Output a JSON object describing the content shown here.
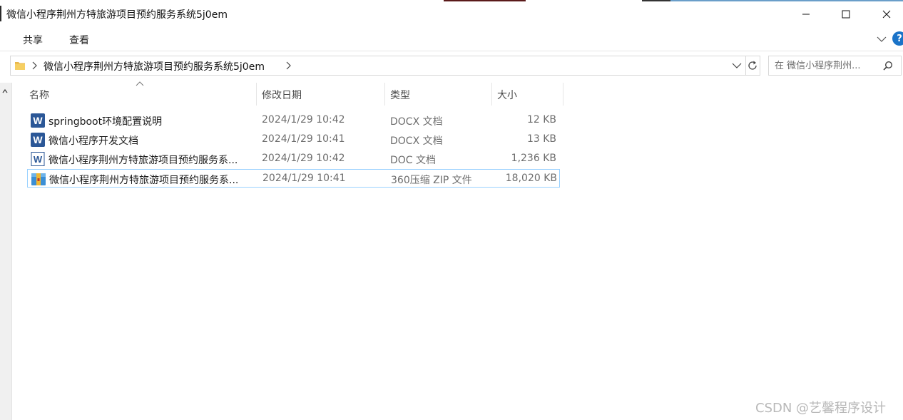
{
  "window": {
    "title": "微信小程序荆州方特旅游项目预约服务系统5j0em"
  },
  "ribbon": {
    "tabs": [
      "共享",
      "查看"
    ]
  },
  "address": {
    "path": "微信小程序荆州方特旅游项目预约服务系统5j0em"
  },
  "search": {
    "placeholder": "在 微信小程序荆州..."
  },
  "columns": {
    "name": "名称",
    "date": "修改日期",
    "type": "类型",
    "size": "大小"
  },
  "files": [
    {
      "name": "springboot环境配置说明",
      "date": "2024/1/29 10:42",
      "type": "DOCX 文档",
      "size": "12 KB",
      "icon": "word-docx-icon"
    },
    {
      "name": "微信小程序开发文档",
      "date": "2024/1/29 10:41",
      "type": "DOCX 文档",
      "size": "13 KB",
      "icon": "word-docx-icon"
    },
    {
      "name": "微信小程序荆州方特旅游项目预约服务系...",
      "date": "2024/1/29 10:42",
      "type": "DOC 文档",
      "size": "1,236 KB",
      "icon": "word-doc-icon"
    },
    {
      "name": "微信小程序荆州方特旅游项目预约服务系...",
      "date": "2024/1/29 10:41",
      "type": "360压缩 ZIP 文件",
      "size": "18,020 KB",
      "icon": "zip-archive-icon"
    }
  ],
  "watermark": "CSDN @艺馨程序设计",
  "colors": {
    "word_blue": "#2b5797",
    "selection_border": "#99d1ff",
    "help_blue": "#1a73c8"
  }
}
